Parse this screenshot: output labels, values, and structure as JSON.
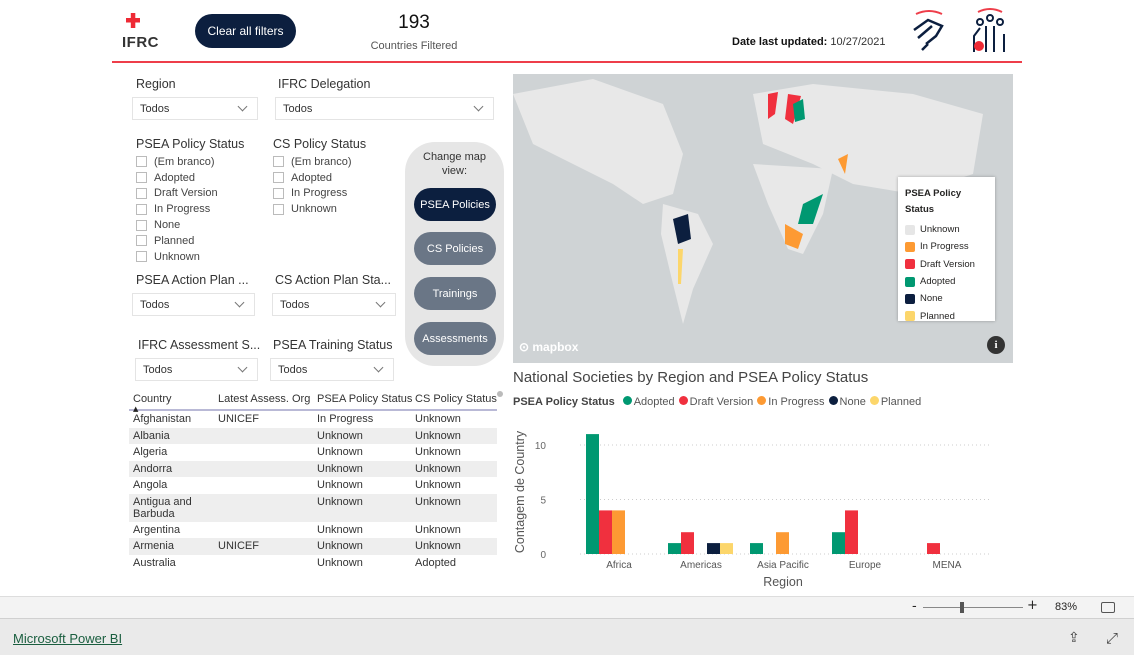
{
  "header": {
    "logo_text": "IFRC",
    "clear_filters_label": "Clear all filters",
    "countries_count": "193",
    "countries_label": "Countries Filtered",
    "date_label": "Date last updated:",
    "date_value": "10/27/2021"
  },
  "filters": {
    "region": {
      "label": "Region",
      "value": "Todos"
    },
    "delegation": {
      "label": "IFRC Delegation",
      "value": "Todos"
    },
    "psea_policy": {
      "label": "PSEA Policy Status",
      "options": [
        "(Em branco)",
        "Adopted",
        "Draft Version",
        "In Progress",
        "None",
        "Planned",
        "Unknown"
      ]
    },
    "cs_policy": {
      "label": "CS Policy Status",
      "options": [
        "(Em branco)",
        "Adopted",
        "In Progress",
        "Unknown"
      ]
    },
    "psea_action": {
      "label": "PSEA Action Plan ...",
      "value": "Todos"
    },
    "cs_action": {
      "label": "CS Action Plan Sta...",
      "value": "Todos"
    },
    "assessment": {
      "label": "IFRC Assessment S...",
      "value": "Todos"
    },
    "training": {
      "label": "PSEA Training Status",
      "value": "Todos"
    }
  },
  "map_view": {
    "title": "Change map view:",
    "buttons": [
      "PSEA Policies",
      "CS Policies",
      "Trainings",
      "Assessments"
    ],
    "active": "PSEA Policies"
  },
  "table": {
    "headers": [
      "Country",
      "Latest Assess. Org",
      "PSEA Policy Status",
      "CS Policy Status"
    ],
    "rows": [
      [
        "Afghanistan",
        "UNICEF",
        "In Progress",
        "Unknown"
      ],
      [
        "Albania",
        "",
        "Unknown",
        "Unknown"
      ],
      [
        "Algeria",
        "",
        "Unknown",
        "Unknown"
      ],
      [
        "Andorra",
        "",
        "Unknown",
        "Unknown"
      ],
      [
        "Angola",
        "",
        "Unknown",
        "Unknown"
      ],
      [
        "Antigua and Barbuda",
        "",
        "Unknown",
        "Unknown"
      ],
      [
        "Argentina",
        "",
        "Unknown",
        "Unknown"
      ],
      [
        "Armenia",
        "UNICEF",
        "Unknown",
        "Unknown"
      ],
      [
        "Australia",
        "",
        "Unknown",
        "Adopted"
      ]
    ]
  },
  "map": {
    "attribution": "mapbox",
    "legend": {
      "title": "PSEA Policy Status",
      "items": [
        {
          "label": "Unknown",
          "color": "#e6e6e6"
        },
        {
          "label": "In Progress",
          "color": "#fd9a33"
        },
        {
          "label": "Draft Version",
          "color": "#f0303e"
        },
        {
          "label": "Adopted",
          "color": "#009871"
        },
        {
          "label": "None",
          "color": "#0c1f3f"
        },
        {
          "label": "Planned",
          "color": "#fcd66b"
        }
      ]
    }
  },
  "chart_data": {
    "type": "bar",
    "title": "National Societies by Region and PSEA Policy Status",
    "legend_title": "PSEA Policy Status",
    "legend_position": "top-left",
    "xlabel": "Region",
    "ylabel": "Contagem de Country",
    "ylim": [
      0,
      11.5
    ],
    "yticks": [
      0,
      5,
      10
    ],
    "grid": true,
    "categories": [
      "Africa",
      "Americas",
      "Asia Pacific",
      "Europe",
      "MENA"
    ],
    "series": [
      {
        "name": "Adopted",
        "color": "#009871",
        "values": [
          11,
          1,
          1,
          2,
          0
        ]
      },
      {
        "name": "Draft Version",
        "color": "#f0303e",
        "values": [
          4,
          2,
          0,
          4,
          1
        ]
      },
      {
        "name": "In Progress",
        "color": "#fd9a33",
        "values": [
          4,
          0,
          2,
          0,
          0
        ]
      },
      {
        "name": "None",
        "color": "#0c1f3f",
        "values": [
          0,
          1,
          0,
          0,
          0
        ]
      },
      {
        "name": "Planned",
        "color": "#fcd66b",
        "values": [
          0,
          1,
          0,
          0,
          0
        ]
      }
    ]
  },
  "bottom": {
    "zoom": "83%",
    "minus": "-",
    "plus": "+",
    "powerbi_link": "Microsoft Power BI"
  }
}
